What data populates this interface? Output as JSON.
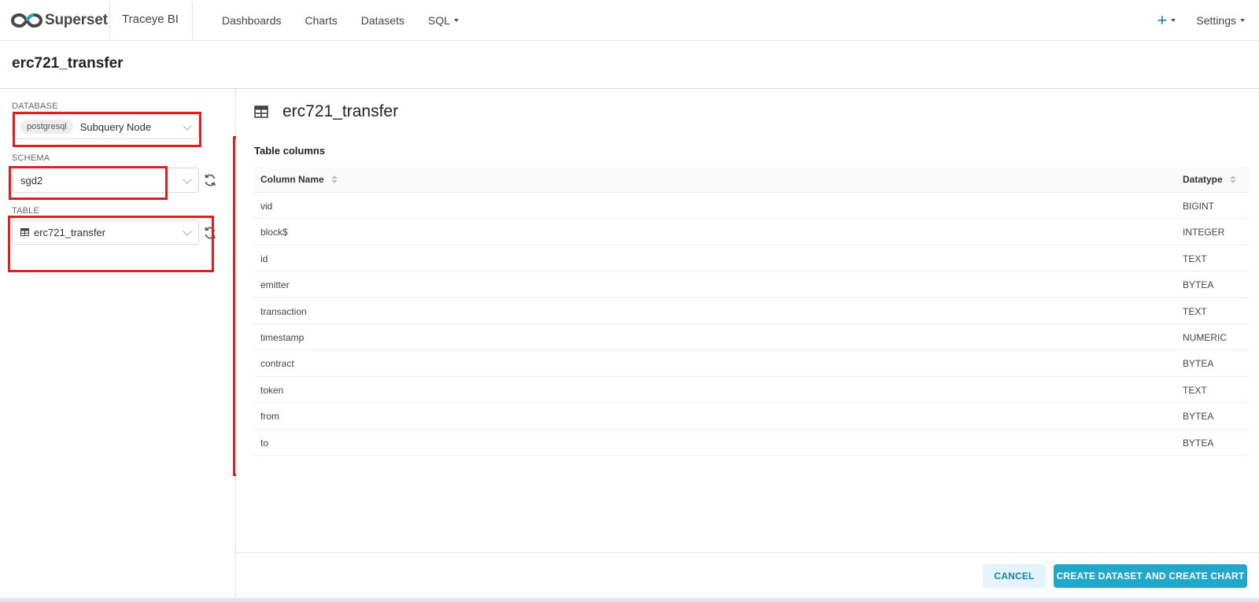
{
  "navbar": {
    "brand": "Superset",
    "workspace": "Traceye BI",
    "links": [
      {
        "label": "Dashboards",
        "has_caret": false
      },
      {
        "label": "Charts",
        "has_caret": false
      },
      {
        "label": "Datasets",
        "has_caret": false
      },
      {
        "label": "SQL",
        "has_caret": true
      }
    ],
    "plus_label": "+",
    "settings_label": "Settings"
  },
  "page": {
    "title": "erc721_transfer"
  },
  "left_panel": {
    "database": {
      "label": "DATABASE",
      "tag": "postgresql",
      "name": "Subquery Node"
    },
    "schema": {
      "label": "SCHEMA",
      "value": "sgd2"
    },
    "table": {
      "label": "TABLE",
      "value": "erc721_transfer"
    }
  },
  "main": {
    "title": "erc721_transfer",
    "section_label": "Table columns",
    "headers": {
      "column_name": "Column Name",
      "datatype": "Datatype"
    },
    "rows": [
      {
        "name": "vid",
        "type": "BIGINT"
      },
      {
        "name": "block$",
        "type": "INTEGER"
      },
      {
        "name": "id",
        "type": "TEXT"
      },
      {
        "name": "emitter",
        "type": "BYTEA"
      },
      {
        "name": "transaction",
        "type": "TEXT"
      },
      {
        "name": "timestamp",
        "type": "NUMERIC"
      },
      {
        "name": "contract",
        "type": "BYTEA"
      },
      {
        "name": "token",
        "type": "TEXT"
      },
      {
        "name": "from",
        "type": "BYTEA"
      },
      {
        "name": "to",
        "type": "BYTEA"
      }
    ]
  },
  "footer": {
    "cancel_label": "CANCEL",
    "create_label": "CREATE DATASET AND CREATE CHART"
  },
  "colors": {
    "accent": "#20a7c9",
    "accent_text": "#1a85a0",
    "highlight_box": "#e02020"
  }
}
